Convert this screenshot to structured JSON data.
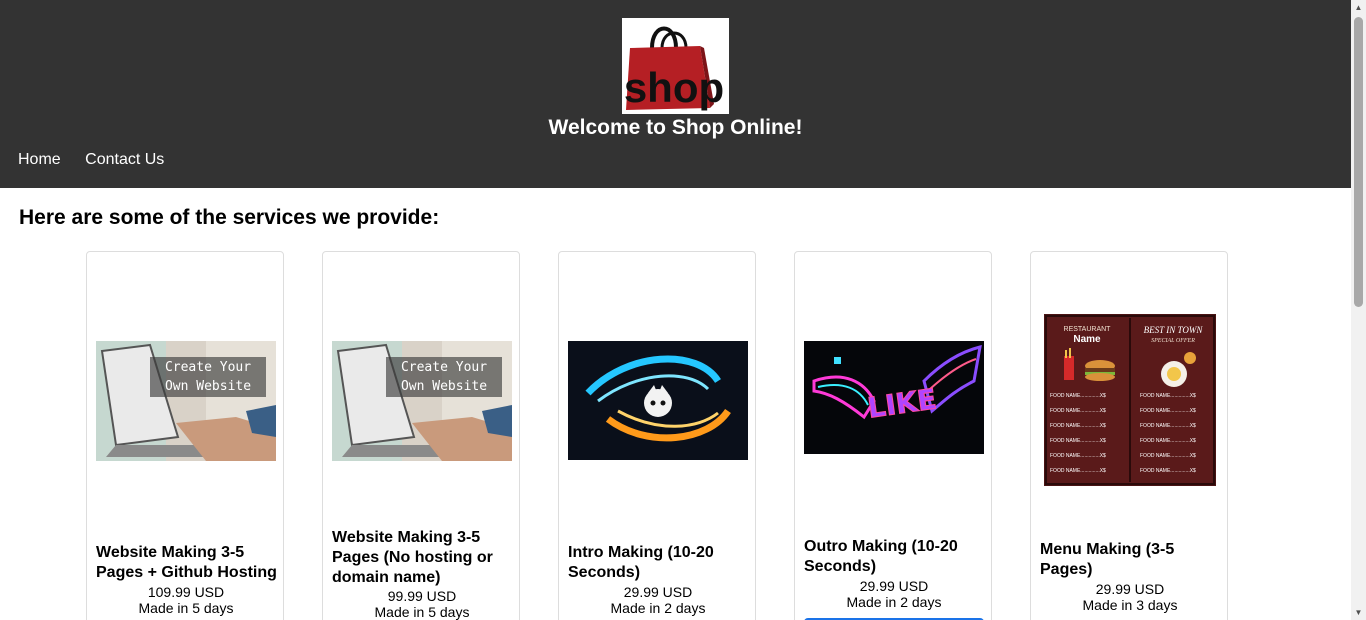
{
  "header": {
    "logo_text": "shop",
    "title": "Welcome to Shop Online!",
    "nav": [
      {
        "label": "Home"
      },
      {
        "label": "Contact Us"
      }
    ]
  },
  "main": {
    "section_title": "Here are some of the services we provide:",
    "products": [
      {
        "name": "Website Making 3-5 Pages + Github Hosting",
        "price": "109.99 USD",
        "delivery": "Made in 5 days",
        "image_text": [
          "Create Your",
          "Own Website"
        ]
      },
      {
        "name": "Website Making 3-5 Pages (No hosting or domain name)",
        "price": "99.99 USD",
        "delivery": "Made in 5 days",
        "image_text": [
          "Create Your",
          "Own Website"
        ]
      },
      {
        "name": "Intro Making (10-20 Seconds)",
        "price": "29.99 USD",
        "delivery": "Made in 2 days"
      },
      {
        "name": "Outro Making (10-20 Seconds)",
        "price": "29.99 USD",
        "delivery": "Made in 2 days",
        "image_text": [
          "LIKE"
        ]
      },
      {
        "name": "Menu Making (3-5 Pages)",
        "price": "29.99 USD",
        "delivery": "Made in 3 days",
        "image_text": [
          "RESTAURANT",
          "Name",
          "BEST IN TOWN",
          "SPECIAL OFFER",
          "FOOD NAME..............X$"
        ]
      }
    ]
  },
  "colors": {
    "header_bg": "#333333",
    "accent": "#1a73e8",
    "logo_bag": "#b51f24"
  }
}
